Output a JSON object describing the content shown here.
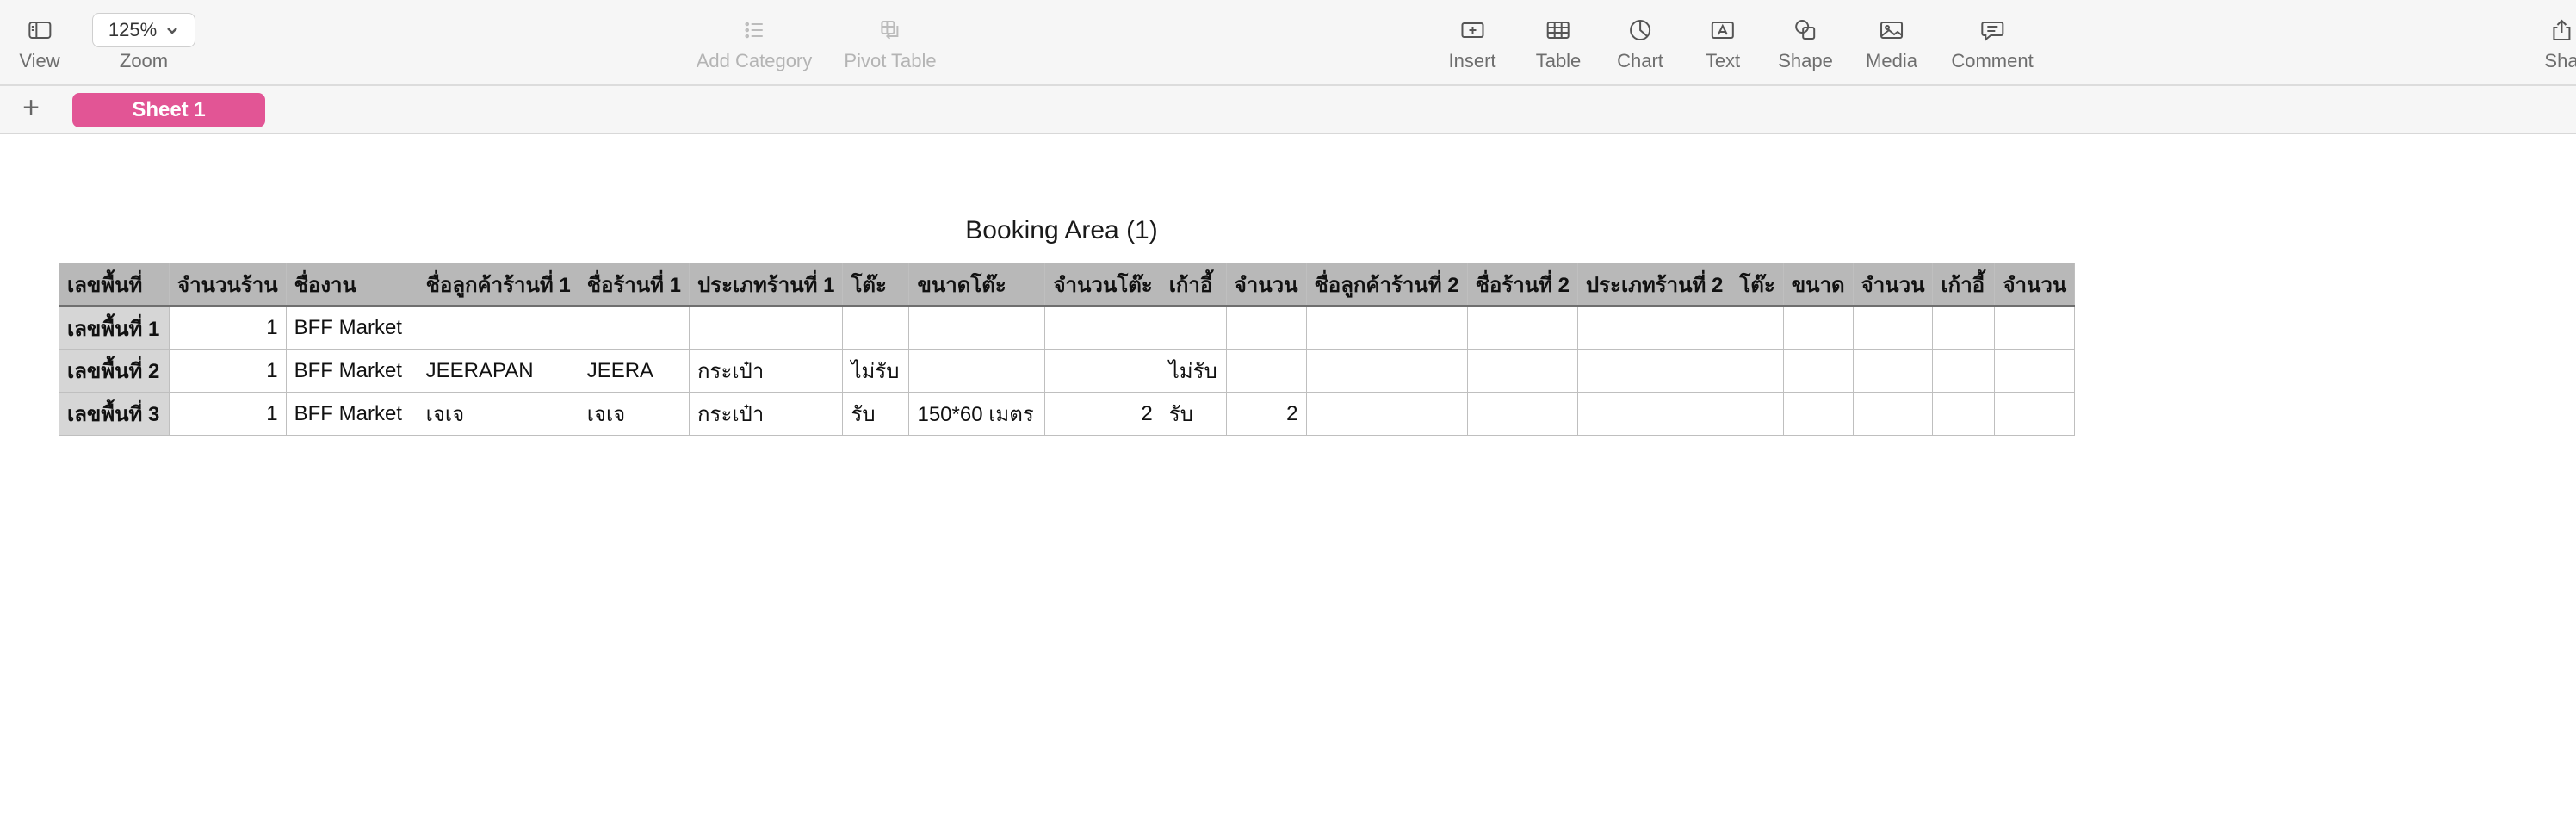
{
  "toolbar": {
    "view_label": "View",
    "zoom_value": "125%",
    "zoom_label": "Zoom",
    "add_category_label": "Add Category",
    "pivot_table_label": "Pivot Table",
    "insert_label": "Insert",
    "table_label": "Table",
    "chart_label": "Chart",
    "text_label": "Text",
    "shape_label": "Shape",
    "media_label": "Media",
    "comment_label": "Comment",
    "share_label": "Sha"
  },
  "tabs": {
    "add_symbol": "+",
    "active_sheet": "Sheet 1",
    "active_color": "#e25595"
  },
  "table": {
    "title": "Booking Area (1)",
    "headers": [
      "เลขพื้นที่",
      "จำนวนร้าน",
      "ชื่องาน",
      "ชื่อลูกค้าร้านที่ 1",
      "ชื่อร้านที่ 1",
      "ประเภทร้านที่ 1",
      "โต๊ะ",
      "ขนาดโต๊ะ",
      "จำนวนโต๊ะ",
      "เก้าอี้",
      "จำนวน",
      "ชื่อลูกค้าร้านที่ 2",
      "ชื่อร้านที่ 2",
      "ประเภทร้านที่ 2",
      "โต๊ะ",
      "ขนาด",
      "จำนวน",
      "เก้าอี้",
      "จำนวน"
    ],
    "rows": [
      [
        "เลขพื้นที่ 1",
        "1",
        "BFF Market",
        "",
        "",
        "",
        "",
        "",
        "",
        "",
        "",
        "",
        "",
        "",
        "",
        "",
        "",
        "",
        ""
      ],
      [
        "เลขพื้นที่ 2",
        "1",
        "BFF Market",
        "JEERAPAN",
        "JEERA",
        "กระเป๋า",
        "ไม่รับ",
        "",
        "",
        "ไม่รับ",
        "",
        "",
        "",
        "",
        "",
        "",
        "",
        "",
        ""
      ],
      [
        "เลขพื้นที่ 3",
        "1",
        "BFF Market",
        "เจเจ",
        "เจเจ",
        "กระเป๋า",
        "รับ",
        "150*60 เมตร",
        "2",
        "รับ",
        "2",
        "",
        "",
        "",
        "",
        "",
        "",
        "",
        ""
      ]
    ]
  }
}
